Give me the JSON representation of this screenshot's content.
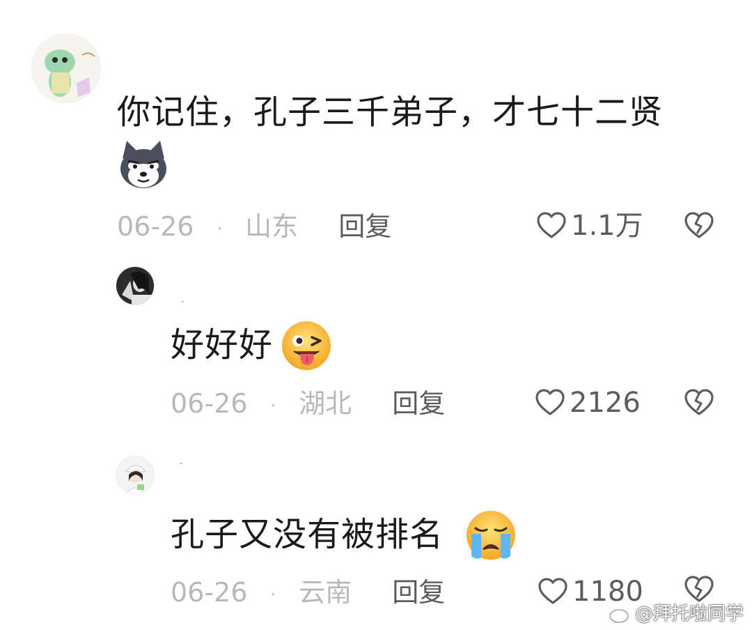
{
  "comments": [
    {
      "text": "你记住，孔子三千弟子，才七十二贤",
      "emoji": "husky-dog-emoji",
      "date": "06-26",
      "separator": "·",
      "region": "山东",
      "reply_label": "回复",
      "likes": "1.1万"
    },
    {
      "text": "好好好",
      "emoji": "tongue-wink-emoji",
      "date": "06-26",
      "separator": "·",
      "region": "湖北",
      "reply_label": "回复",
      "likes": "2126"
    },
    {
      "text": "孔子又没有被排名",
      "emoji": "crying-face-emoji",
      "date": "06-26",
      "separator": "·",
      "region": "云南",
      "reply_label": "回复",
      "likes": "1180"
    }
  ],
  "watermark": {
    "text": "@拜托啦同学",
    "icon": "weibo-logo-icon"
  },
  "colors": {
    "text": "#1a1a1a",
    "meta": "#b8b8b8",
    "action": "#5c5c5c",
    "background": "#ffffff"
  }
}
